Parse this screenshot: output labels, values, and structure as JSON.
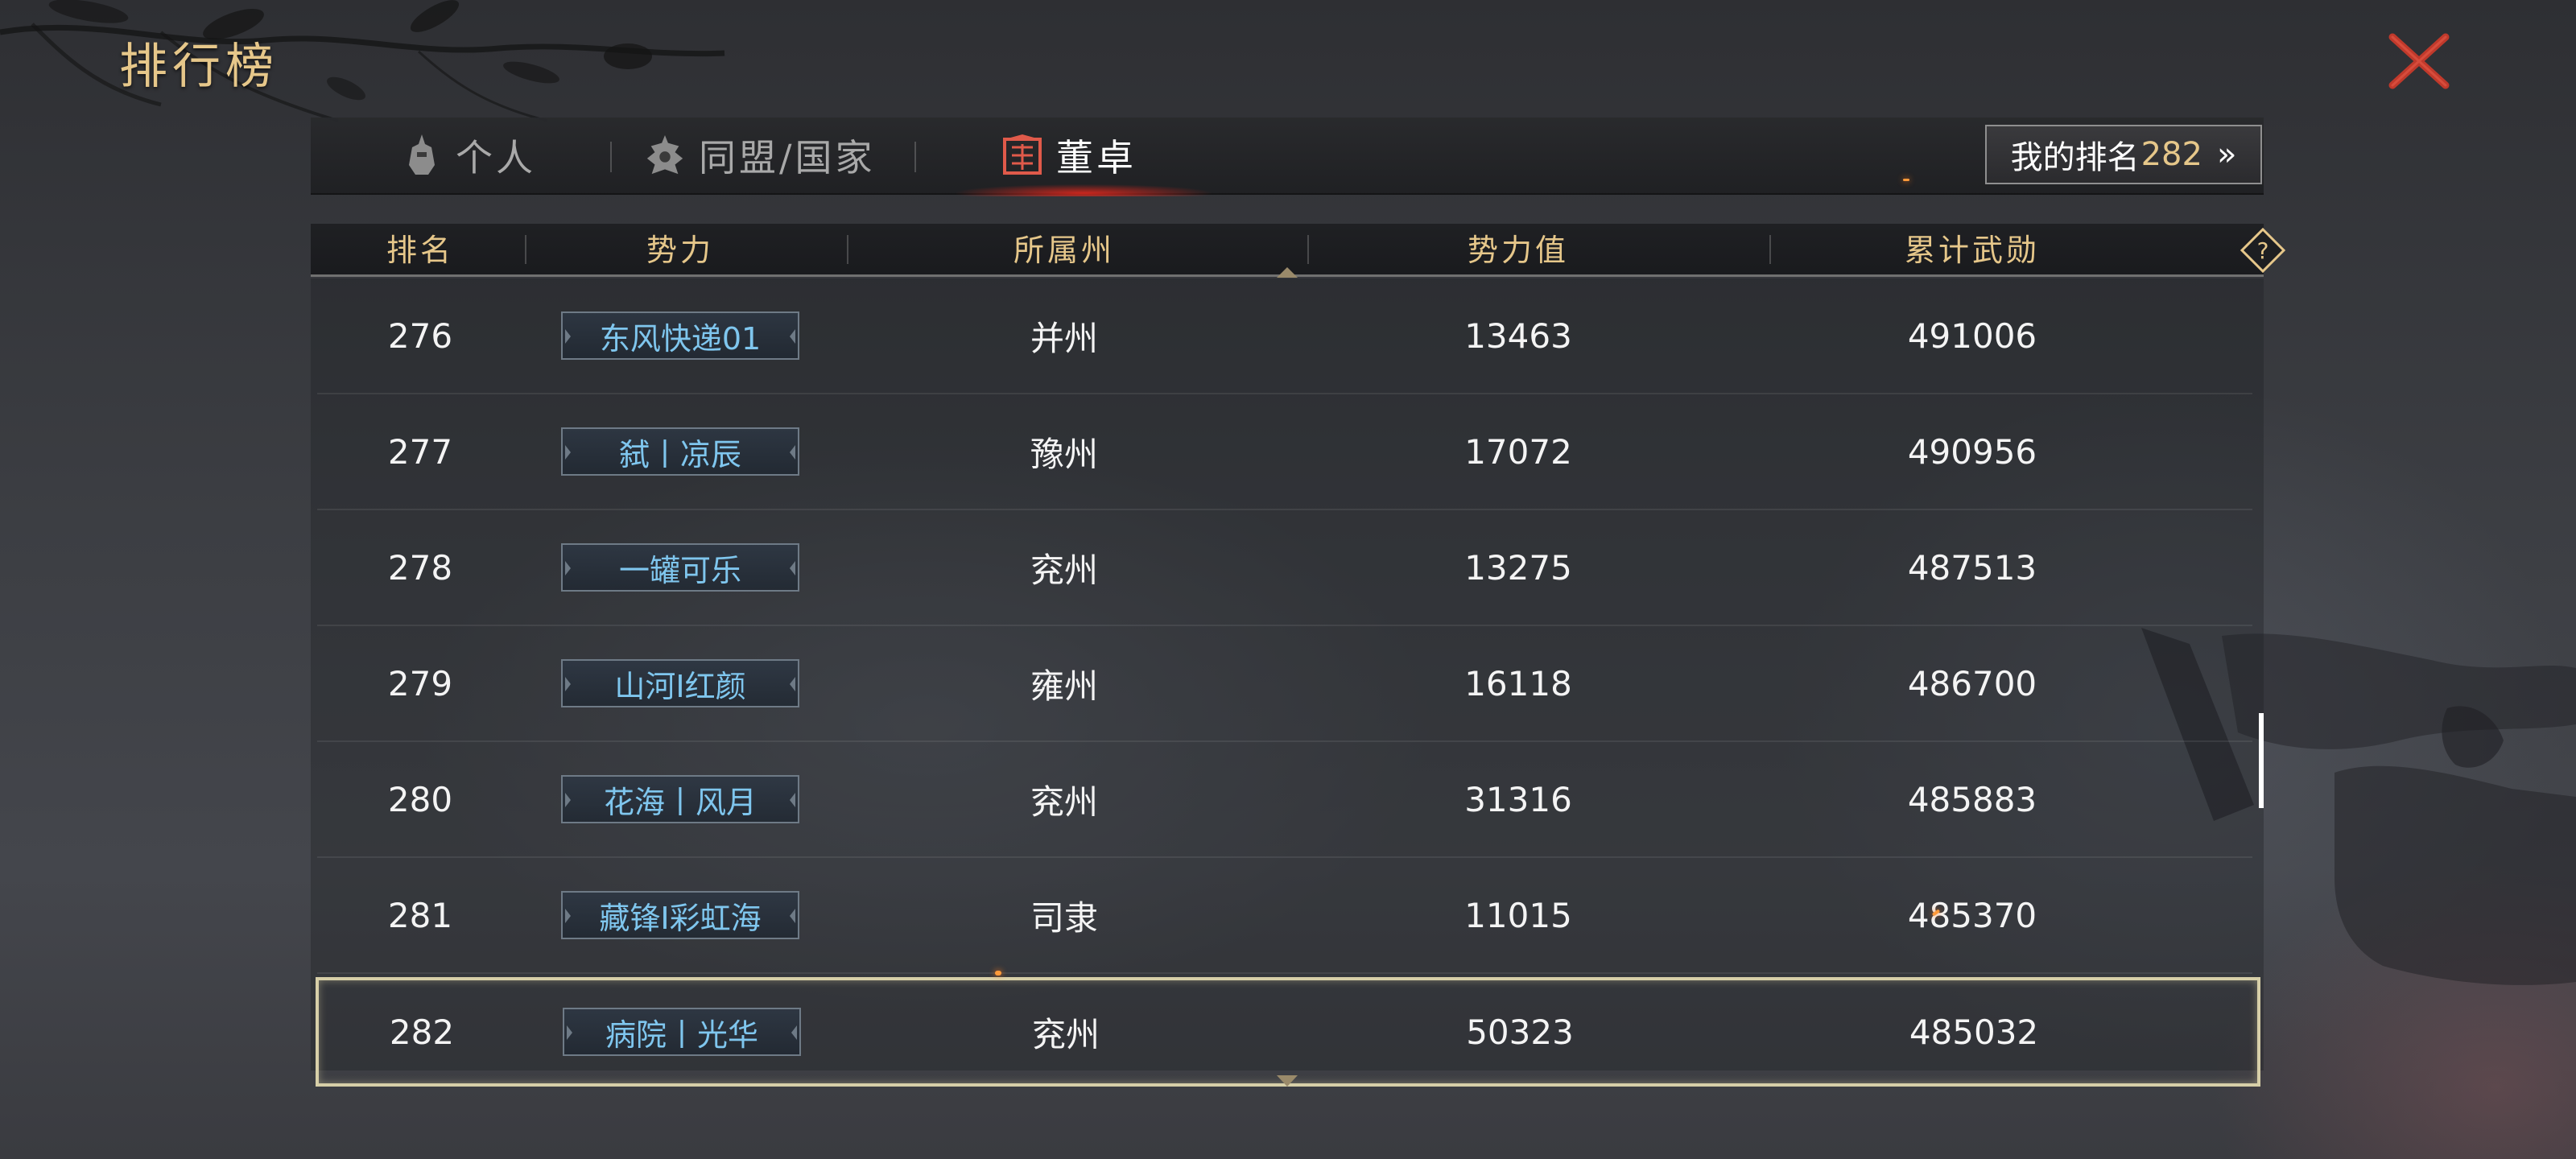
{
  "title": "排行榜",
  "tabs": [
    {
      "label": "个人",
      "active": false,
      "icon": "helmet-icon"
    },
    {
      "label": "同盟/国家",
      "active": false,
      "icon": "warship-icon"
    },
    {
      "label": "董卓",
      "active": true,
      "icon": "banner-icon"
    }
  ],
  "my_rank": {
    "label": "我的排名",
    "value": "282",
    "chevron": "»"
  },
  "columns": [
    "排名",
    "势力",
    "所属州",
    "势力值",
    "累计武勋"
  ],
  "help_icon_label": "?",
  "rows": [
    {
      "rank": "276",
      "faction": "东风快递01",
      "state": "并州",
      "power": "13463",
      "merit": "491006"
    },
    {
      "rank": "277",
      "faction": "弑丨凉辰",
      "state": "豫州",
      "power": "17072",
      "merit": "490956"
    },
    {
      "rank": "278",
      "faction": "一罐可乐",
      "state": "兖州",
      "power": "13275",
      "merit": "487513"
    },
    {
      "rank": "279",
      "faction": "山河I红颜",
      "state": "雍州",
      "power": "16118",
      "merit": "486700"
    },
    {
      "rank": "280",
      "faction": "花海丨风月",
      "state": "兖州",
      "power": "31316",
      "merit": "485883"
    },
    {
      "rank": "281",
      "faction": "藏锋I彩虹海",
      "state": "司隶",
      "power": "11015",
      "merit": "485370"
    },
    {
      "rank": "282",
      "faction": "病院丨光华",
      "state": "兖州",
      "power": "50323",
      "merit": "485032"
    }
  ],
  "selected_rank": "282",
  "colors": {
    "gold": "#e6c78a",
    "faction_blue": "#7fc6ee",
    "close_red": "#c0392b",
    "highlight": "#d7cfa8"
  }
}
